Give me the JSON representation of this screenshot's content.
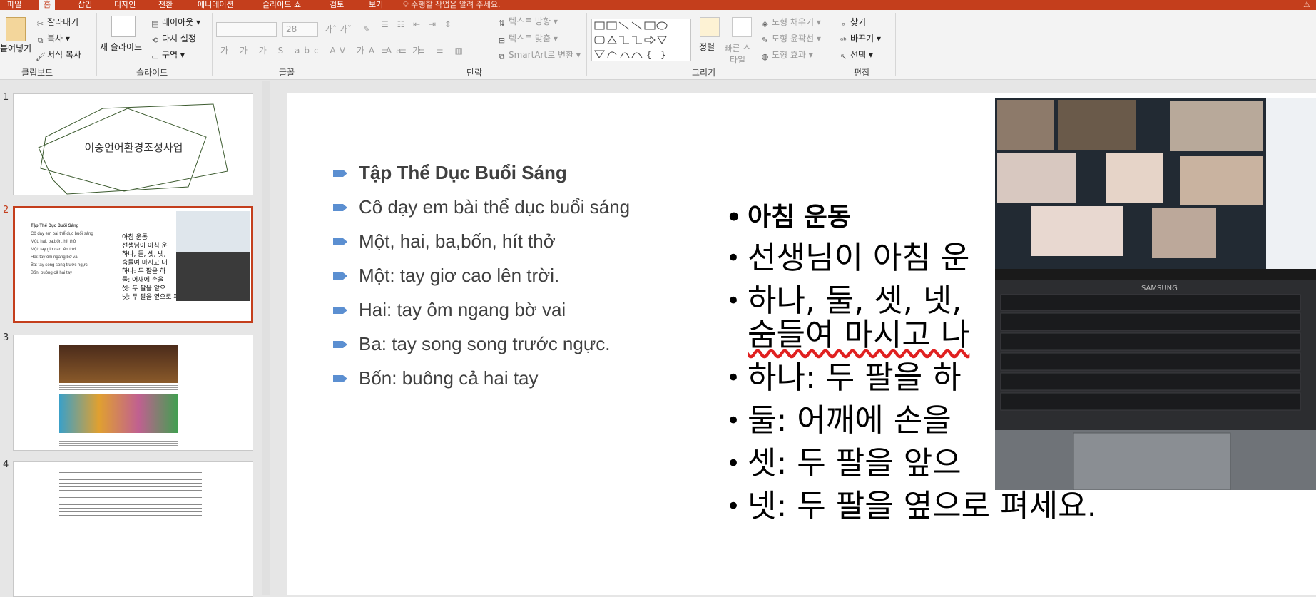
{
  "tabs": [
    "파일",
    "홈",
    "삽입",
    "디자인",
    "전환",
    "애니메이션",
    "슬라이드 쇼",
    "검토",
    "보기"
  ],
  "tell_me": "수행할 작업을 알려 주세요.",
  "ribbon": {
    "clipboard": {
      "paste": "붙여넣기",
      "cut": "잘라내기",
      "copy": "복사",
      "format_painter": "서식 복사",
      "label": "클립보드"
    },
    "slides": {
      "new_slide": "새 슬라이드",
      "layout": "레이아웃",
      "reset": "다시 설정",
      "section": "구역",
      "label": "슬라이드"
    },
    "font": {
      "size": "28",
      "label": "글꼴"
    },
    "paragraph": {
      "text_direction": "텍스트 방향",
      "align_text": "텍스트 맞춤",
      "smartart": "SmartArt로 변환",
      "label": "단락"
    },
    "drawing": {
      "arrange": "정렬",
      "quick_styles": "빠른 스타일",
      "shape_fill": "도형 채우기",
      "shape_outline": "도형 윤곽선",
      "shape_effects": "도형 효과",
      "label": "그리기"
    },
    "editing": {
      "find": "찾기",
      "replace": "바꾸기",
      "select": "선택",
      "label": "편집"
    }
  },
  "thumbnails": {
    "numbers": [
      "1",
      "2",
      "3",
      "4"
    ],
    "slide1_title": "이중언어환경조성사업",
    "slide2_viet": [
      "Tập Thể Dục Buổi Sáng",
      "Cô dạy em bài thể dục buổi sáng",
      "Một, hai, ba,bốn, hít thở",
      "Một: tay giơ cao lên trời.",
      "Hai: tay ôm ngang bờ vai",
      "Ba: tay song song trước ngực.",
      "Bốn: buông cả hai tay"
    ],
    "slide2_kor": [
      "아침 운동",
      "선생님이 아침 운",
      "하나, 둘, 셋, 넷,",
      "숨들여 마시고 내",
      "하나: 두 팔을 하",
      "둘: 어깨에 손을",
      "셋: 두 팔을 앞으",
      "넷: 두 팔을 옆으로 펴세요."
    ]
  },
  "slide": {
    "viet_bullets": [
      "Tập Thể Dục Buổi Sáng",
      "Cô dạy em bài thể dục buổi sáng",
      "Một, hai, ba,bốn, hít thở",
      "Một: tay giơ cao lên trời.",
      "Hai: tay ôm ngang bờ vai",
      "Ba: tay song song trước ngực.",
      "Bốn: buông cả hai tay"
    ],
    "kor_bullets": [
      "아침 운동",
      "선생님이 아침 운",
      "하나, 둘, 셋, 넷,",
      "숨들여 마시고 나",
      "하나: 두 팔을 하",
      "둘: 어깨에 손을",
      "셋: 두 팔을 앞으",
      "넷: 두 팔을 옆으로 펴세요."
    ],
    "photo_brand": "SAMSUNG"
  },
  "colors": {
    "accent": "#c43e1c",
    "bullet_arrow": "#5b8fd1"
  }
}
